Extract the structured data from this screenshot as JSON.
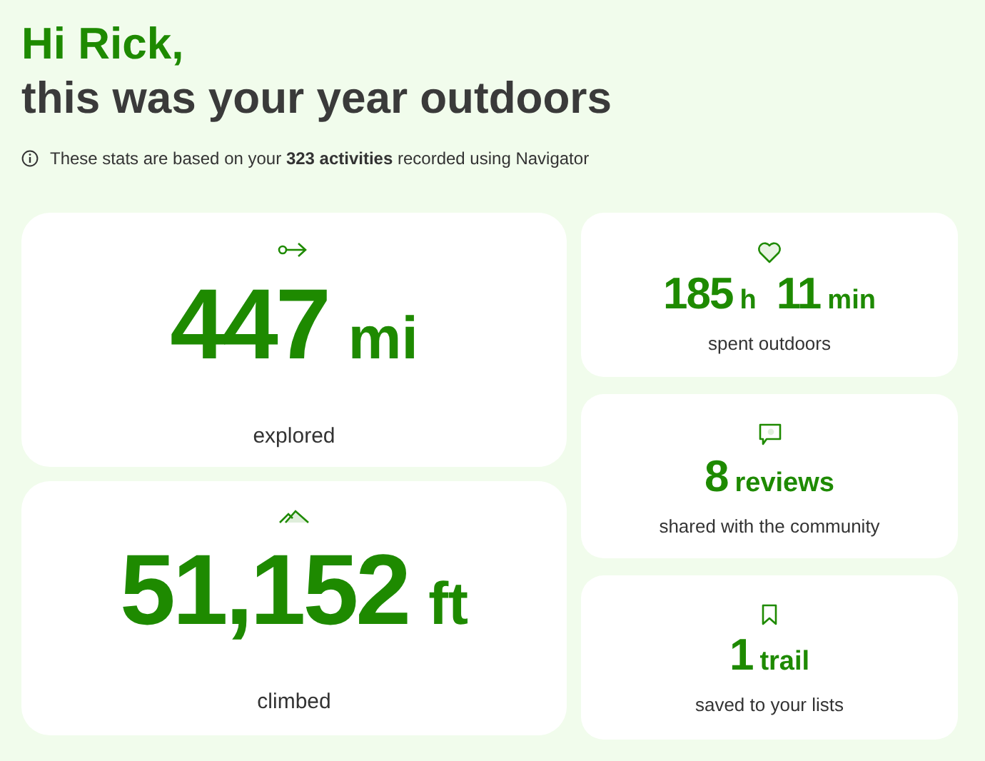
{
  "greeting": {
    "name_line": "Hi Rick,",
    "title": "this was your year outdoors"
  },
  "info": "These stats are based on your **323 activities** recorded using Navigator",
  "main_stats": [
    {
      "value": [
        {
          "number": "447",
          "unit": "mi"
        }
      ],
      "caption": "explored"
    },
    {
      "value": [
        {
          "number": "51,152",
          "unit": "ft"
        }
      ],
      "caption": "climbed"
    }
  ],
  "side_stats": [
    {
      "value": [
        {
          "number": "185",
          "unit": "h"
        },
        {
          "number": "11",
          "unit": "min"
        }
      ],
      "caption": "spent outdoors"
    },
    {
      "value": [
        {
          "number": "8",
          "unit": "reviews"
        }
      ],
      "caption": "shared with the community"
    },
    {
      "value": [
        {
          "number": "1",
          "unit": "trail"
        }
      ],
      "caption": "saved to your lists"
    }
  ]
}
